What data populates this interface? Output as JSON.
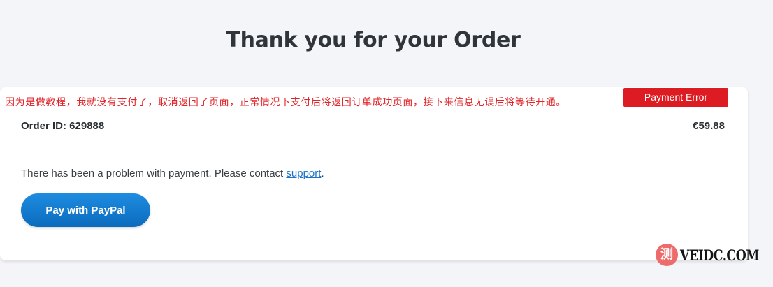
{
  "page": {
    "title": "Thank you for your Order"
  },
  "annotation": {
    "text": "因为是做教程，我就没有支付了，取消返回了页面，正常情况下支付后将返回订单成功页面，接下来信息无误后将等待开通。"
  },
  "order": {
    "status_badge": "Payment Error",
    "id_label": "Order ID: 629888",
    "total": "€59.88",
    "message_prefix": "There has been a problem with payment. Please contact ",
    "support_link": "support",
    "message_suffix": ".",
    "pay_button": "Pay with PayPal"
  },
  "watermark": {
    "seal_char": "测",
    "text": "VEIDC.COM"
  },
  "colors": {
    "background": "#f4f5f8",
    "error_badge": "#dc1c22",
    "annotation": "#e0252a",
    "paypal_button": "#1580d3",
    "link": "#1a73c8"
  }
}
